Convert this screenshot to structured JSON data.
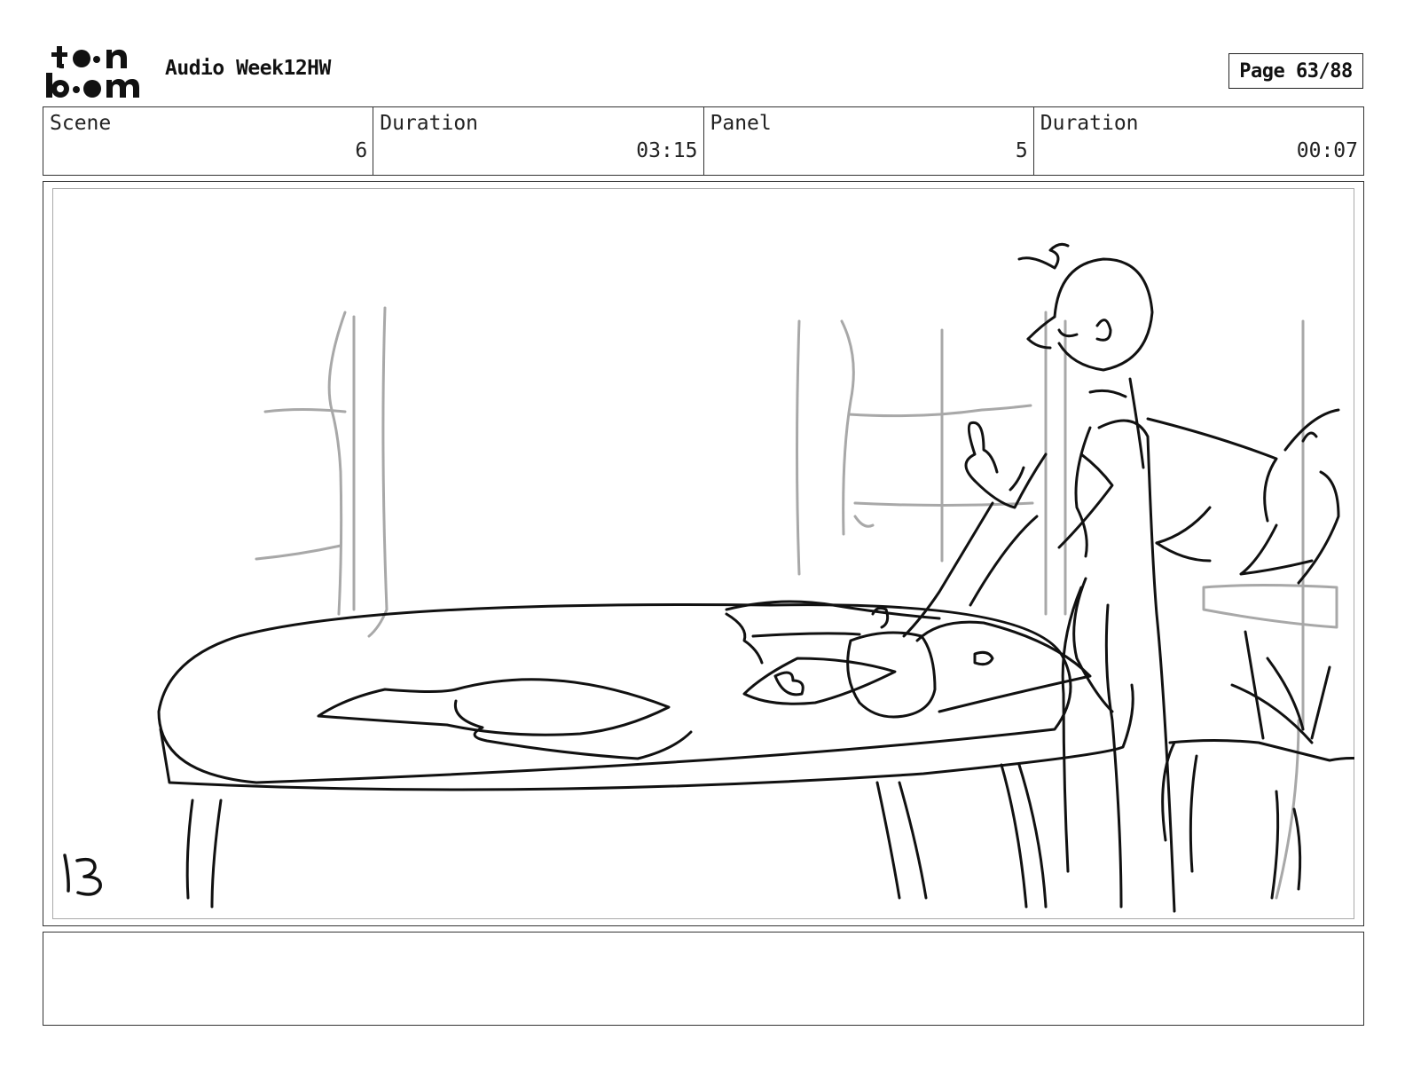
{
  "header": {
    "logo_text": "toon boom",
    "project_title": "Audio Week12HW",
    "page_label": "Page 63/88"
  },
  "info": {
    "scene_label": "Scene",
    "scene_value": "6",
    "scene_duration_label": "Duration",
    "scene_duration_value": "03:15",
    "panel_label": "Panel",
    "panel_value": "5",
    "panel_duration_label": "Duration",
    "panel_duration_value": "00:07"
  },
  "panel": {
    "sketch_number": "13",
    "ink_color": "#111111",
    "guide_color": "#a8a8a8"
  },
  "notes": {
    "text": ""
  }
}
